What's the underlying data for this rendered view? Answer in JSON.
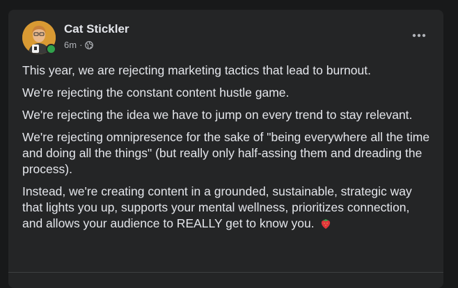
{
  "post": {
    "author": "Cat Stickler",
    "timestamp": "6m",
    "separator": "·",
    "audience_icon": "globe-icon",
    "more_icon": "more-options-icon",
    "paragraphs": [
      "This year, we are rejecting marketing tactics that lead to burnout.",
      "We're rejecting the constant content hustle game.",
      "We're rejecting the idea we have to jump on every trend to stay relevant.",
      "We're rejecting omnipresence for the sake of \"being everywhere all the time and doing all the things\" (but really only half-assing them and dreading the process).",
      "Instead, we're creating content in a grounded, sustainable, strategic way that lights you up, supports your mental wellness, prioritizes connection, and allows your audience to REALLY get to know you."
    ],
    "trailing_emoji": "strawberry-emoji"
  },
  "colors": {
    "card_bg": "#242526",
    "page_bg": "#18191a",
    "primary_text": "#e4e6eb",
    "secondary_text": "#b0b3b8",
    "online_status": "#31a24c"
  }
}
